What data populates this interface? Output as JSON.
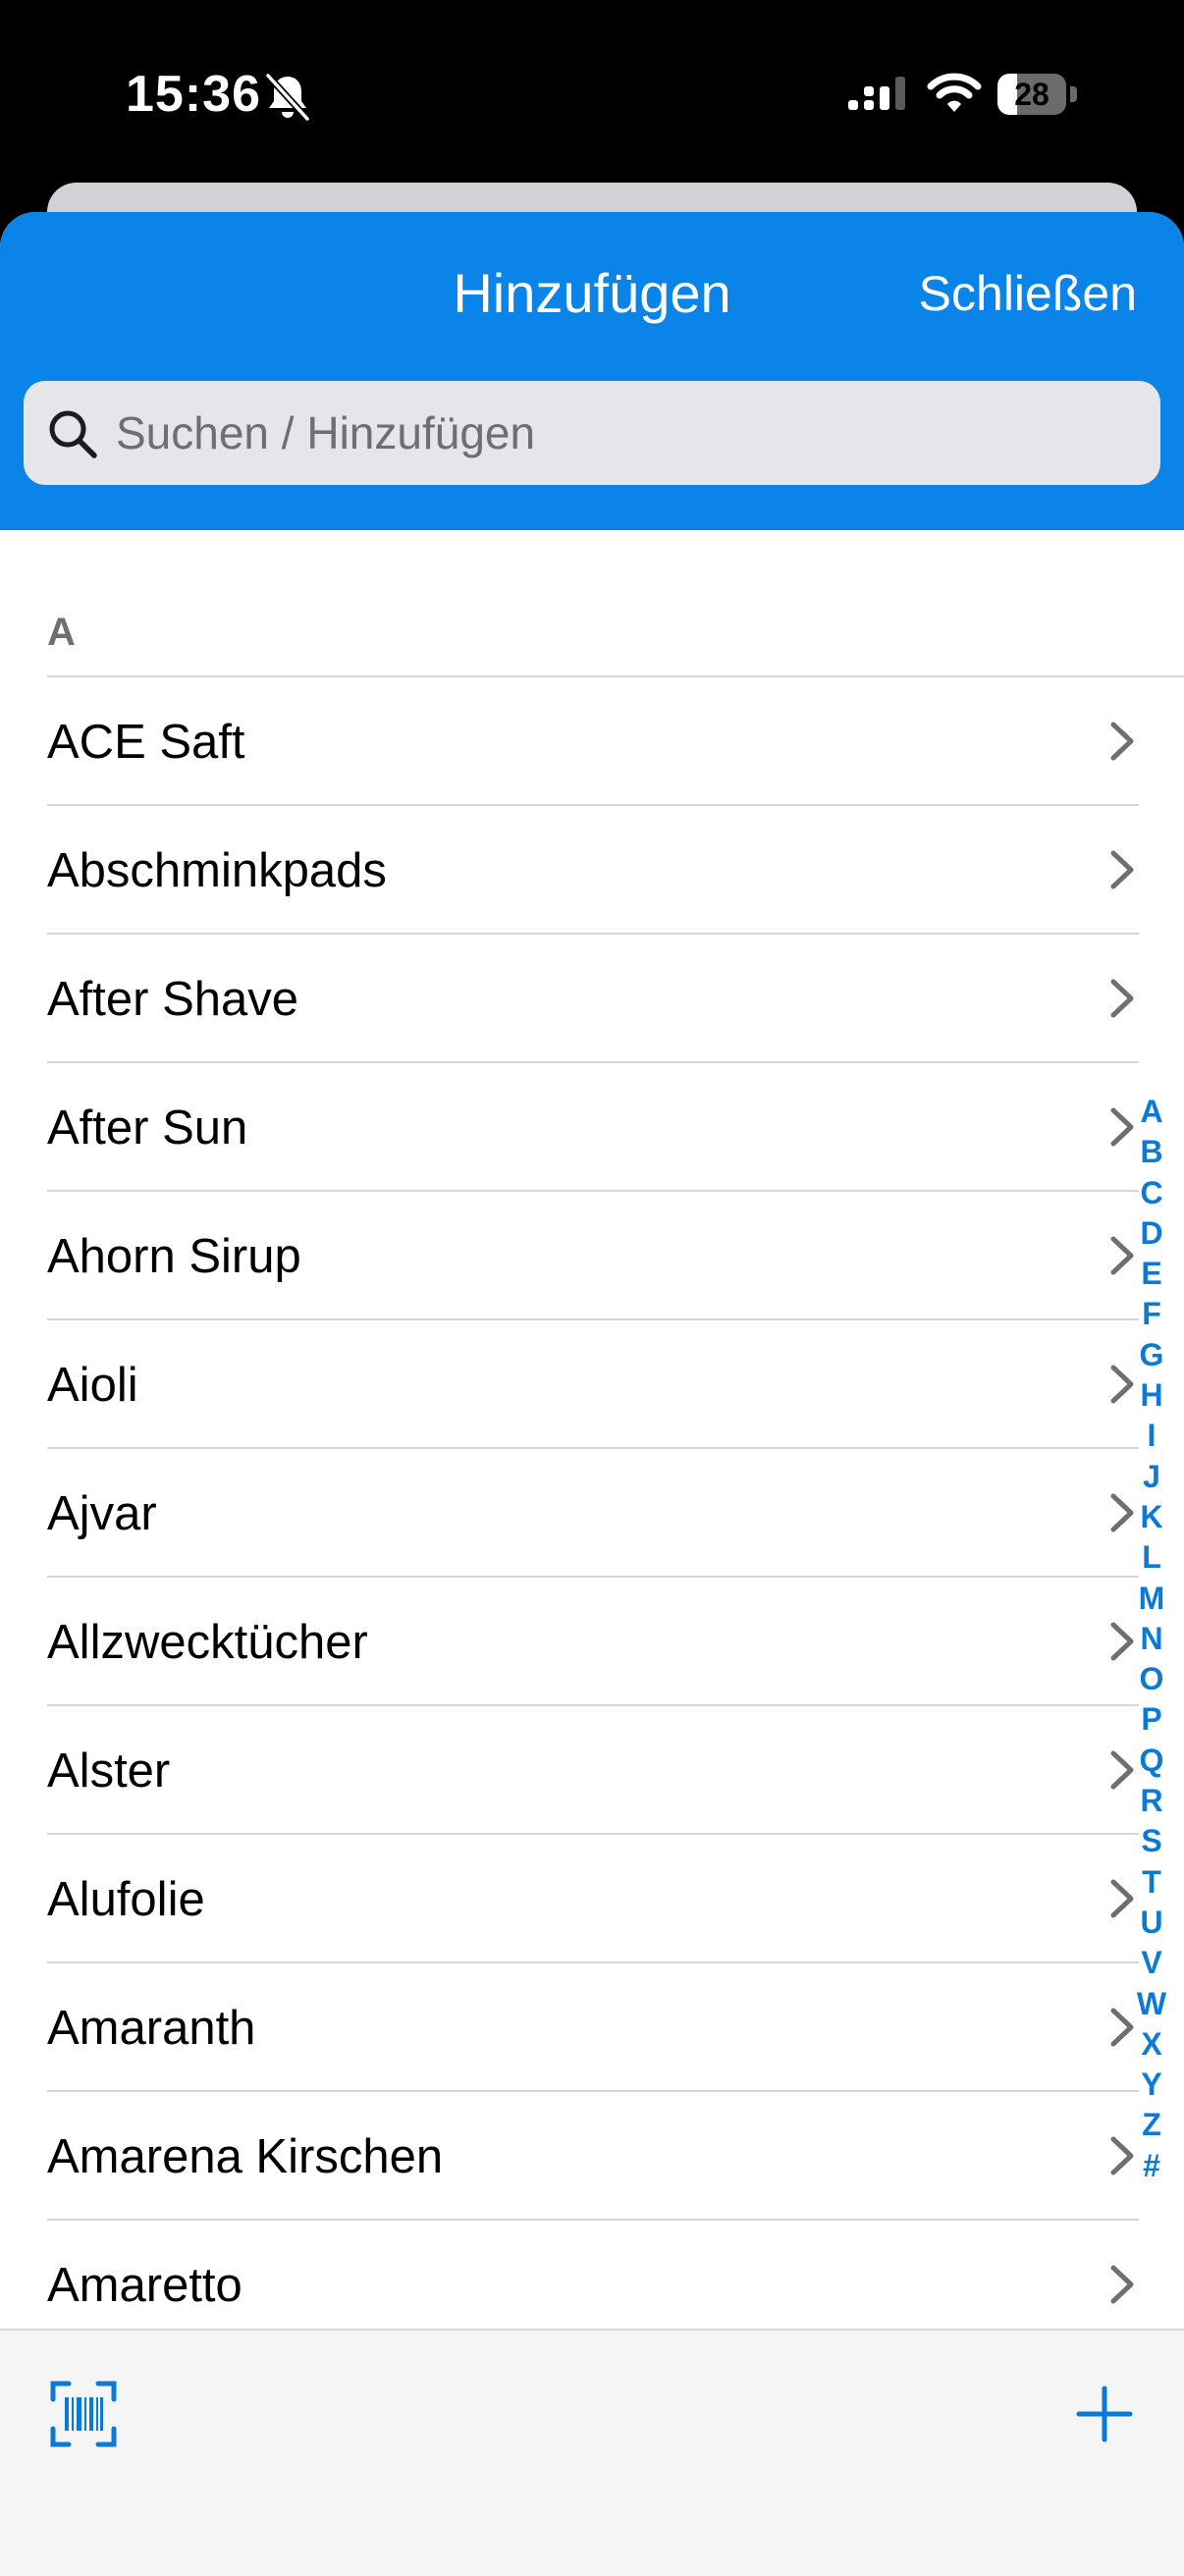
{
  "status_bar": {
    "time": "15:36",
    "battery": "28",
    "battery_level": 0.28,
    "icons": [
      "bell-slash-icon",
      "cellular-signal-icon",
      "wifi-icon",
      "battery-icon"
    ]
  },
  "nav": {
    "title": "Hinzufügen",
    "close_label": "Schließen",
    "background_color": "#0a84e8"
  },
  "search": {
    "placeholder": "Suchen / Hinzufügen",
    "value": ""
  },
  "list": {
    "section_header": "A",
    "items": [
      "ACE Saft",
      "Abschminkpads",
      "After Shave",
      "After Sun",
      "Ahorn Sirup",
      "Aioli",
      "Ajvar",
      "Allzwecktücher",
      "Alster",
      "Alufolie",
      "Amaranth",
      "Amarena Kirschen",
      "Amaretto"
    ]
  },
  "index": [
    "A",
    "B",
    "C",
    "D",
    "E",
    "F",
    "G",
    "H",
    "I",
    "J",
    "K",
    "L",
    "M",
    "N",
    "O",
    "P",
    "Q",
    "R",
    "S",
    "T",
    "U",
    "V",
    "W",
    "X",
    "Y",
    "Z",
    "#"
  ],
  "toolbar": {
    "icons": [
      "barcode-scan-icon",
      "plus-icon"
    ],
    "accent_color": "#0a7ad6"
  }
}
